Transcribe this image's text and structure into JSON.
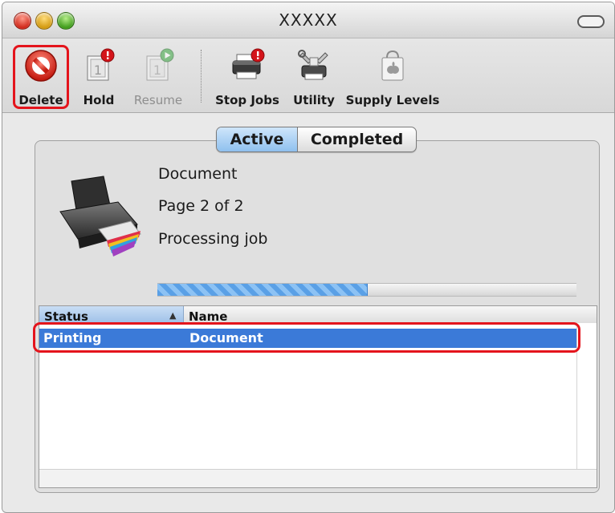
{
  "window": {
    "title": "XXXXX"
  },
  "toolbar": {
    "delete_label": "Delete",
    "hold_label": "Hold",
    "resume_label": "Resume",
    "stop_jobs_label": "Stop Jobs",
    "utility_label": "Utility",
    "supply_levels_label": "Supply Levels"
  },
  "tabs": {
    "active": "Active",
    "completed": "Completed",
    "selected": "Active"
  },
  "job": {
    "title": "Document",
    "page": "Page 2 of 2",
    "status": "Processing job",
    "progress": 0.5
  },
  "table": {
    "columns": [
      "Status",
      "Name"
    ],
    "rows": [
      {
        "status": "Printing",
        "name": "Document",
        "selected": true
      }
    ]
  },
  "icons": {
    "delete": "delete-no-sign-icon",
    "hold": "hold-page-alert-icon",
    "resume": "resume-page-play-icon",
    "stop_jobs": "printer-alert-icon",
    "utility": "printer-tools-icon",
    "supply_levels": "supply-bag-icon"
  },
  "colors": {
    "highlight": "#3b7ad8",
    "annotation": "#e4141c",
    "progress": "#5aa0e6"
  }
}
